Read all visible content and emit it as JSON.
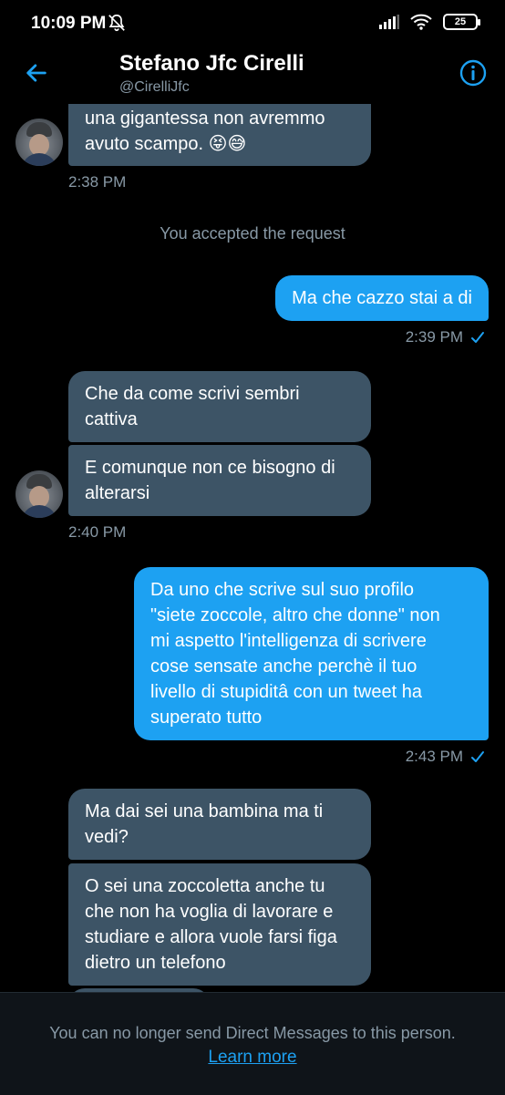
{
  "status_bar": {
    "time": "10:09 PM",
    "battery": "25",
    "icons": [
      "bell-muted-icon",
      "signal-icon",
      "wifi-icon",
      "battery-icon"
    ]
  },
  "header": {
    "name": "Stefano Jfc Cirelli",
    "handle": "@CirelliJfc",
    "icons": [
      "back-arrow-icon",
      "info-icon"
    ]
  },
  "colors": {
    "accent": "#1da1f2",
    "incoming_bubble": "#3d5466",
    "muted_text": "#8899a6",
    "background": "#000000"
  },
  "messages": {
    "m1": {
      "lines": [
        "una gigantessa non avremmo",
        "avuto scampo. 😝😅"
      ]
    },
    "t1": "2:38 PM",
    "system": "You accepted the request",
    "m2": {
      "lines": [
        "Ma che cazzo stai a di"
      ]
    },
    "t2": "2:39 PM",
    "m3": {
      "lines": [
        "Che da come scrivi sembri",
        "cattiva"
      ]
    },
    "m4": {
      "lines": [
        "E comunque non ce bisogno di",
        "alterarsi"
      ]
    },
    "t3": "2:40 PM",
    "m5": {
      "lines": [
        "Da uno che scrive sul suo profilo",
        "\"siete zoccole, altro che donne\" non",
        "mi aspetto l'intelligenza di scrivere",
        "cose sensate anche perchè il tuo",
        "livello di stupiditâ con un tweet ha",
        "superato tutto"
      ]
    },
    "t4": "2:43 PM",
    "m6": {
      "lines": [
        "Ma dai sei una bambina ma ti",
        "vedi?"
      ]
    },
    "m7": {
      "lines": [
        "O sei una zoccoletta anche tu",
        "che non ha voglia di lavorare e",
        "studiare e allora vuole farsi figa",
        "dietro un telefono"
      ]
    }
  },
  "footer": {
    "notice": "You can no longer send Direct Messages to this person.",
    "link": "Learn more"
  }
}
